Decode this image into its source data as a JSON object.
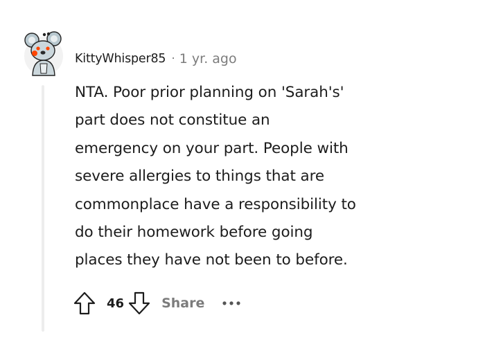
{
  "comment": {
    "author": "KittyWhisper85",
    "separator": "·",
    "timestamp": "1 yr. ago",
    "body_lines": [
      "NTA. Poor prior planning on 'Sarah's'",
      "part does not constitue an",
      "emergency on your part. People with",
      "severe allergies to things that are",
      "commonplace have a responsibility to",
      "do their homework before going",
      "places they have not been to before."
    ],
    "score": "46",
    "share_label": "Share"
  },
  "icons": {
    "avatar": "snoo-koala-avatar",
    "upvote": "upvote-arrow-icon",
    "downvote": "downvote-arrow-icon",
    "more": "more-options-icon"
  },
  "colors": {
    "text": "#1c1c1c",
    "meta": "#7c7c7c",
    "thread_line": "#ededed",
    "avatar_accent": "#ff4500"
  }
}
